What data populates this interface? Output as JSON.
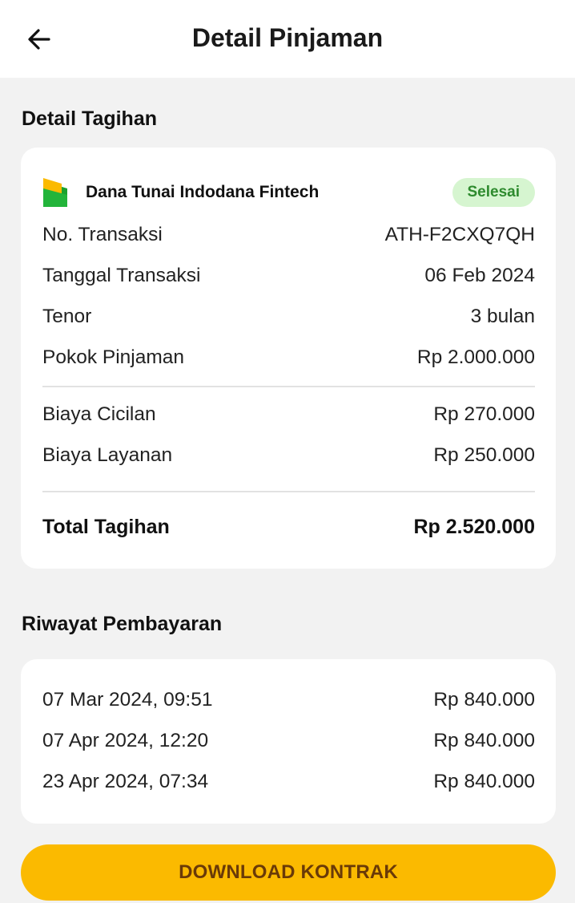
{
  "header": {
    "title": "Detail Pinjaman",
    "back_icon": "arrow-left-icon"
  },
  "bill": {
    "section_title": "Detail Tagihan",
    "lender_name": "Dana Tunai Indodana Fintech",
    "status": "Selesai",
    "status_color": "#2e8b2e",
    "status_bg": "#d6f5d0",
    "rows": [
      {
        "label": "No. Transaksi",
        "value": "ATH-F2CXQ7QH"
      },
      {
        "label": "Tanggal Transaksi",
        "value": "06 Feb 2024"
      },
      {
        "label": "Tenor",
        "value": "3 bulan"
      },
      {
        "label": "Pokok Pinjaman",
        "value": "Rp 2.000.000"
      }
    ],
    "fees": [
      {
        "label": "Biaya Cicilan",
        "value": "Rp 270.000"
      },
      {
        "label": "Biaya Layanan",
        "value": "Rp 250.000"
      }
    ],
    "total": {
      "label": "Total Tagihan",
      "value": "Rp 2.520.000"
    }
  },
  "history": {
    "section_title": "Riwayat Pembayaran",
    "payments": [
      {
        "date": "07 Mar 2024, 09:51",
        "amount": "Rp 840.000"
      },
      {
        "date": "07 Apr 2024, 12:20",
        "amount": "Rp 840.000"
      },
      {
        "date": "23 Apr 2024, 07:34",
        "amount": "Rp 840.000"
      }
    ]
  },
  "actions": {
    "download_label": "DOWNLOAD KONTRAK",
    "accent_color": "#fbba00"
  }
}
